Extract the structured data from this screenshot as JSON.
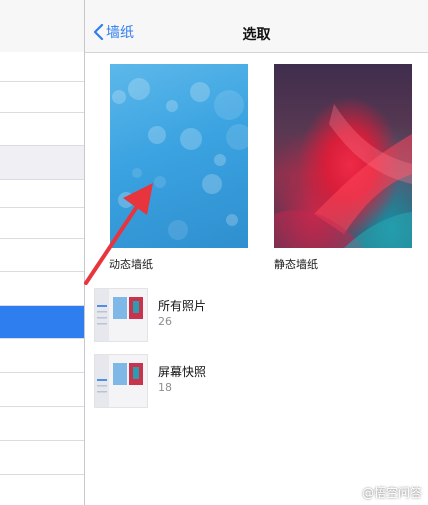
{
  "nav": {
    "back_label": "墙纸",
    "title": "选取"
  },
  "wallpapers": [
    {
      "label": "动态墙纸",
      "icon": "dynamic-wallpaper-thumbnail"
    },
    {
      "label": "静态墙纸",
      "icon": "still-wallpaper-thumbnail"
    }
  ],
  "albums": [
    {
      "name": "所有照片",
      "count": "26"
    },
    {
      "name": "屏幕快照",
      "count": "18"
    }
  ],
  "watermark": {
    "text": "@悟空问答",
    "icon": "wukong-logo-icon"
  },
  "colors": {
    "accent": "#2f7ef0",
    "arrow": "#e8343c",
    "selected_row": "#2f7ef0"
  }
}
